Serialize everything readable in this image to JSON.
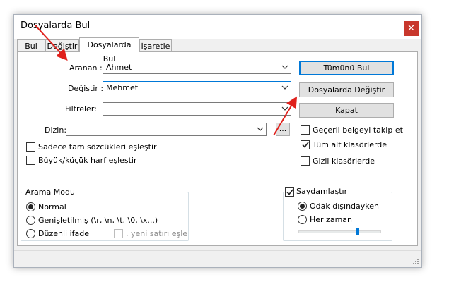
{
  "window": {
    "title": "Dosyalarda Bul",
    "close_glyph": "✕"
  },
  "tabs": [
    {
      "label": "Bul",
      "active": false
    },
    {
      "label": "Değiştir",
      "active": false
    },
    {
      "label": "Dosyalarda Bul",
      "active": true
    },
    {
      "label": "İşaretle",
      "active": false
    }
  ],
  "fields": {
    "find": {
      "label": "Aranan :",
      "value": "Ahmet"
    },
    "replace": {
      "label": "Değiştir :",
      "value": "Mehmet"
    },
    "filters": {
      "label": "Filtreler:",
      "value": ""
    },
    "directory": {
      "label": "Dizin:",
      "value": "",
      "browse_label": "..."
    }
  },
  "buttons": {
    "find_all": "Tümünü Bul",
    "replace_in_files": "Dosyalarda Değiştir",
    "close": "Kapat"
  },
  "options_left": [
    {
      "label": "Sadece tam sözcükleri eşleştir",
      "checked": false
    },
    {
      "label": "Büyük/küçük harf eşleştir",
      "checked": false
    }
  ],
  "options_right": [
    {
      "label": "Geçerli belgeyi takip et",
      "checked": false
    },
    {
      "label": "Tüm alt klasörlerde",
      "checked": true
    },
    {
      "label": "Gizli klasörlerde",
      "checked": false
    }
  ],
  "search_mode": {
    "legend": "Arama Modu",
    "options": [
      {
        "label": "Normal",
        "selected": true
      },
      {
        "label": "Genişletilmiş (\\r, \\n, \\t, \\0, \\x...)",
        "selected": false
      },
      {
        "label": "Düzenli ifade",
        "selected": false
      }
    ],
    "newline_option": {
      "label": ". yeni satırı eşle",
      "checked": false,
      "enabled": false
    }
  },
  "transparency": {
    "label": "Saydamlaştır",
    "checked": true,
    "options": [
      {
        "label": "Odak dışındayken",
        "selected": true
      },
      {
        "label": "Her zaman",
        "selected": false
      }
    ],
    "slider_value": 0.72
  },
  "colors": {
    "accent": "#0078d7",
    "close_button": "#c8372c",
    "annotation_arrow": "#e0201b"
  }
}
